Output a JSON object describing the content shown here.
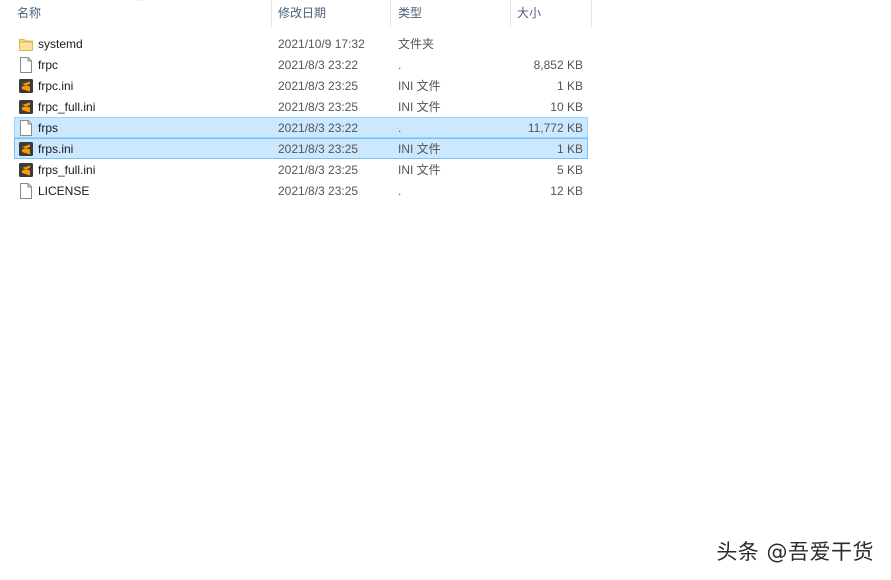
{
  "header": {
    "col_name": "名称",
    "col_date": "修改日期",
    "col_type": "类型",
    "col_size": "大小",
    "sort_arrow": "^"
  },
  "files": [
    {
      "name": "systemd",
      "date": "2021/10/9 17:32",
      "type": "文件夹",
      "size": "",
      "icon": "folder-icon"
    },
    {
      "name": "frpc",
      "date": "2021/8/3 23:22",
      "type": ".",
      "size": "8,852 KB",
      "icon": "file-icon"
    },
    {
      "name": "frpc.ini",
      "date": "2021/8/3 23:25",
      "type": "INI 文件",
      "size": "1 KB",
      "icon": "sublime-icon"
    },
    {
      "name": "frpc_full.ini",
      "date": "2021/8/3 23:25",
      "type": "INI 文件",
      "size": "10 KB",
      "icon": "sublime-icon"
    },
    {
      "name": "frps",
      "date": "2021/8/3 23:22",
      "type": ".",
      "size": "11,772 KB",
      "icon": "file-icon"
    },
    {
      "name": "frps.ini",
      "date": "2021/8/3 23:25",
      "type": "INI 文件",
      "size": "1 KB",
      "icon": "sublime-icon"
    },
    {
      "name": "frps_full.ini",
      "date": "2021/8/3 23:25",
      "type": "INI 文件",
      "size": "5 KB",
      "icon": "sublime-icon"
    },
    {
      "name": "LICENSE",
      "date": "2021/8/3 23:25",
      "type": ".",
      "size": "12 KB",
      "icon": "file-icon"
    }
  ],
  "watermark": "头条 @吾爱干货",
  "colors": {
    "selected_bg": "#cce8ff",
    "selected_border": "#99d1ff",
    "header_text": "#4c607a",
    "folder": "#f8d775",
    "sublime": "#ff9800"
  }
}
